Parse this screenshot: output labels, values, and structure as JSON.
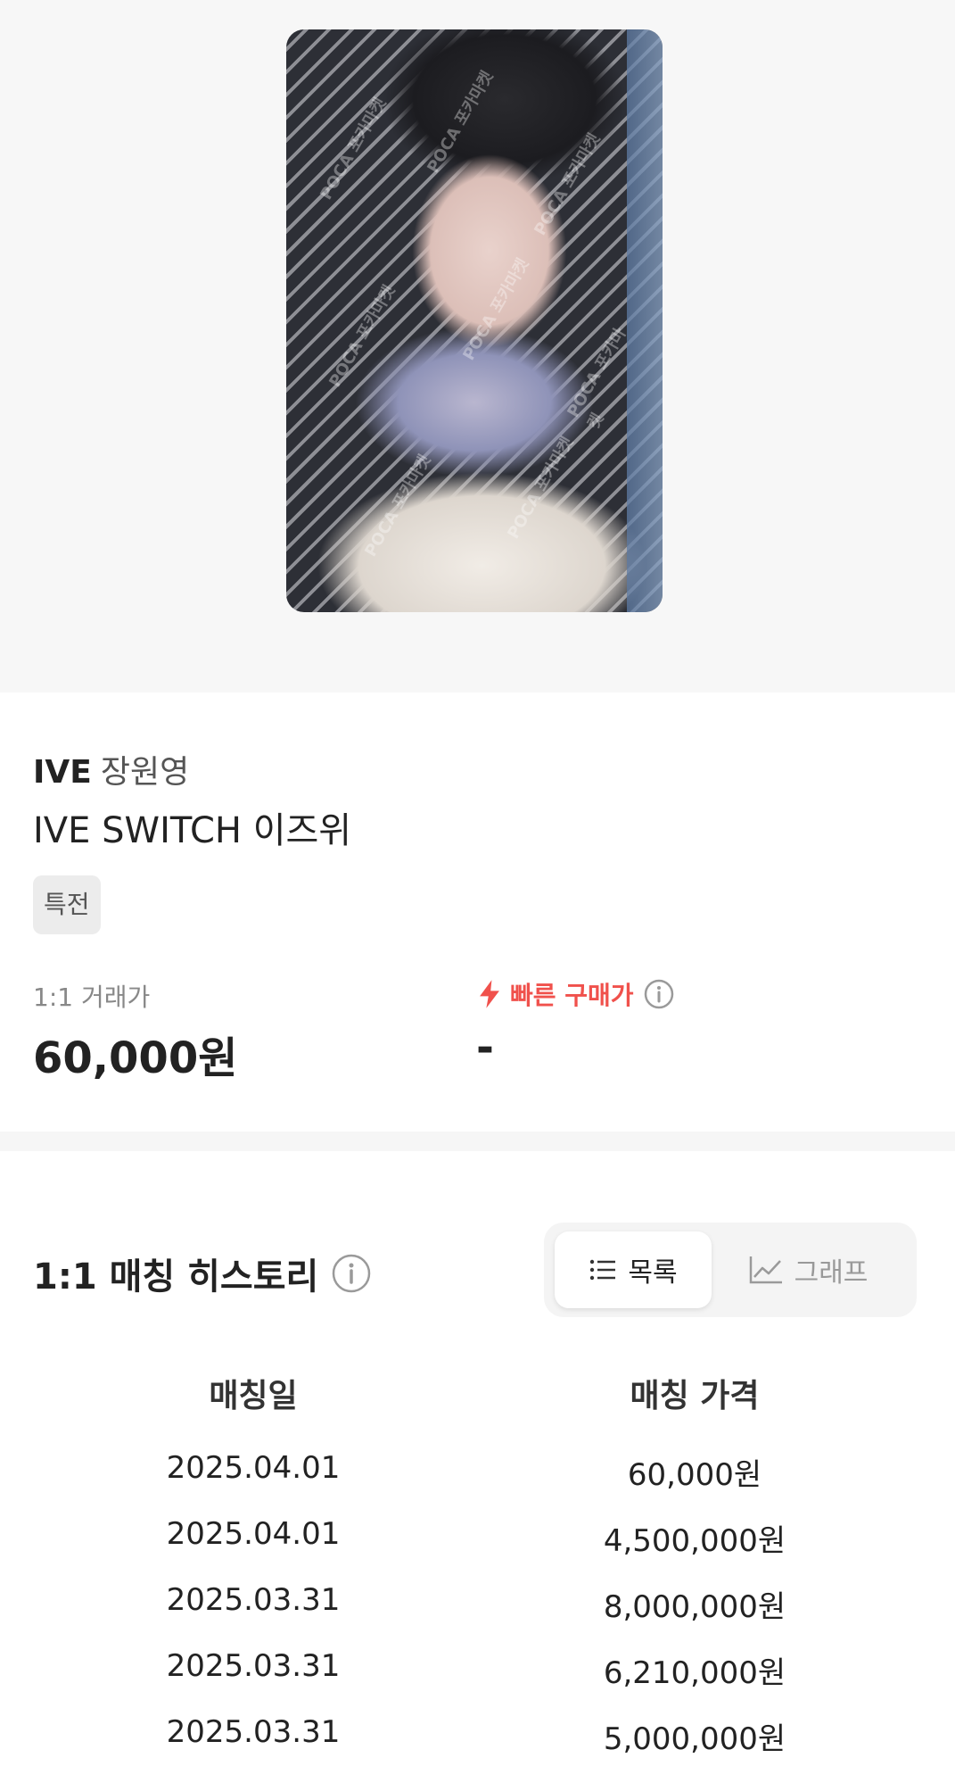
{
  "product": {
    "group": "IVE",
    "member": "장원영",
    "title": "IVE SWITCH 이즈위",
    "badge": "특전",
    "watermark": "POCA 포카마켓"
  },
  "pricing": {
    "trade_price_label": "1:1 거래가",
    "trade_price_value": "60,000원",
    "fast_buy_label": "빠른 구매가",
    "fast_buy_value": "-"
  },
  "history": {
    "title": "1:1 매칭 히스토리",
    "view_toggle": {
      "list_label": "목록",
      "graph_label": "그래프",
      "selected": "목록"
    },
    "columns": [
      "매칭일",
      "매칭 가격"
    ],
    "rows": [
      {
        "date": "2025.04.01",
        "price": "60,000원"
      },
      {
        "date": "2025.04.01",
        "price": "4,500,000원"
      },
      {
        "date": "2025.03.31",
        "price": "8,000,000원"
      },
      {
        "date": "2025.03.31",
        "price": "6,210,000원"
      },
      {
        "date": "2025.03.31",
        "price": "5,000,000원"
      }
    ]
  },
  "colors": {
    "accent_red": "#f0514c",
    "background_gray": "#f7f7f7",
    "text_primary": "#222222",
    "text_muted": "#888888"
  },
  "icons": {
    "fast_buy": "lightning-bolt-icon",
    "info": "info-circle-icon",
    "list": "list-icon",
    "graph": "line-chart-icon"
  }
}
